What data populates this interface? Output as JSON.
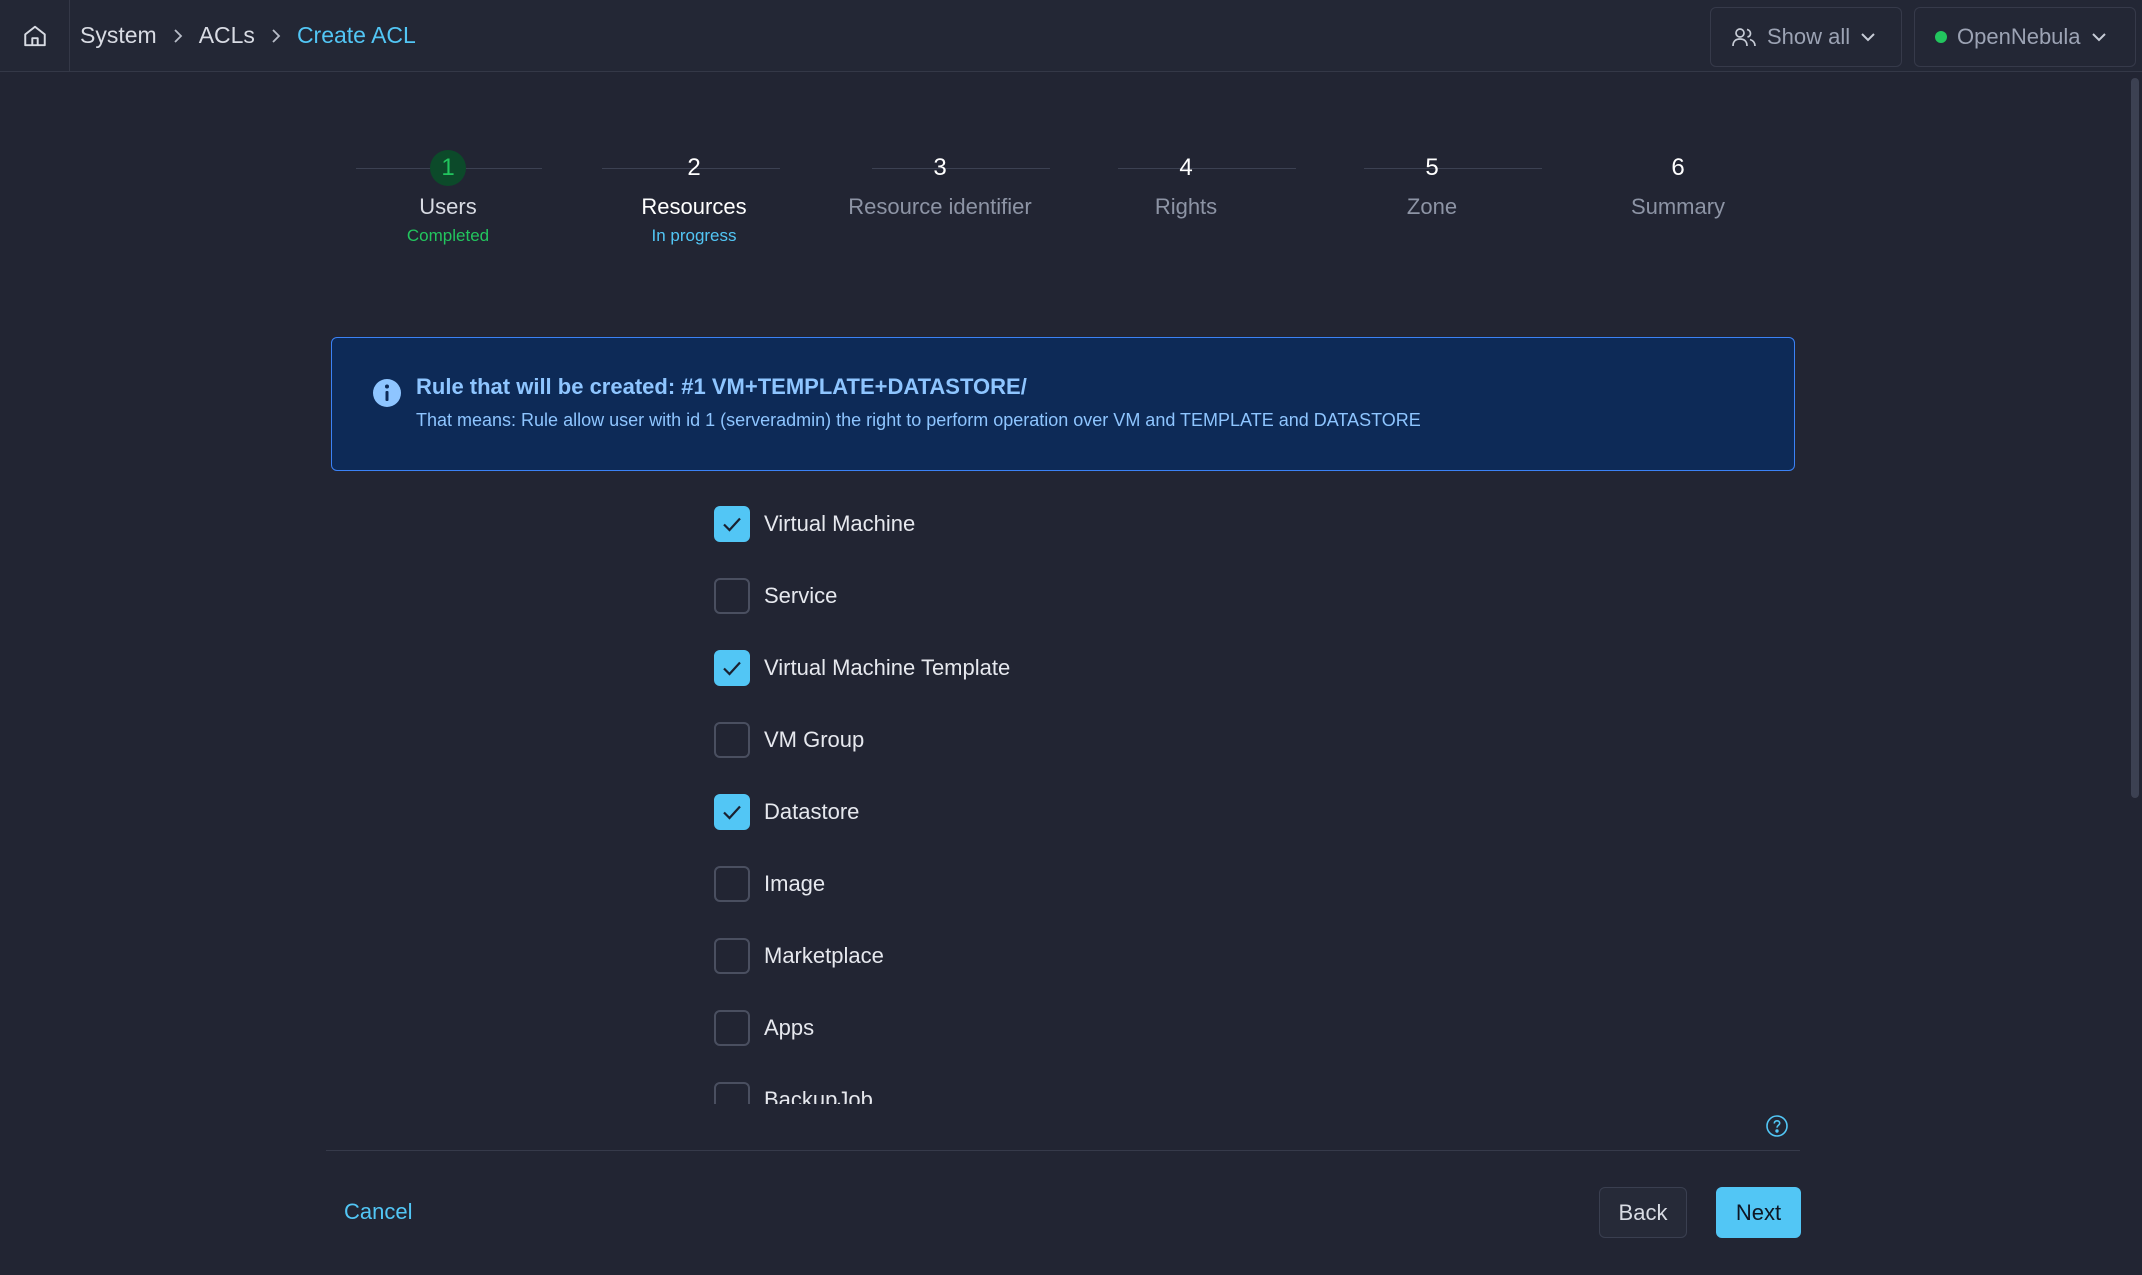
{
  "breadcrumb": {
    "items": [
      "System",
      "ACLs",
      "Create ACL"
    ]
  },
  "header": {
    "show_all_label": "Show all",
    "zone_label": "OpenNebula",
    "zone_status_color": "#22c55e"
  },
  "stepper": {
    "steps": [
      {
        "number": "1",
        "label": "Users",
        "status": "Completed"
      },
      {
        "number": "2",
        "label": "Resources",
        "status": "In progress"
      },
      {
        "number": "3",
        "label": "Resource identifier",
        "status": ""
      },
      {
        "number": "4",
        "label": "Rights",
        "status": ""
      },
      {
        "number": "5",
        "label": "Zone",
        "status": ""
      },
      {
        "number": "6",
        "label": "Summary",
        "status": ""
      }
    ]
  },
  "info": {
    "title": "Rule that will be created: #1 VM+TEMPLATE+DATASTORE/",
    "description": "That means: Rule allow user with id 1 (serveradmin) the right to perform operation over VM and TEMPLATE and DATASTORE"
  },
  "resources": [
    {
      "label": "Virtual Machine",
      "checked": true
    },
    {
      "label": "Service",
      "checked": false
    },
    {
      "label": "Virtual Machine Template",
      "checked": true
    },
    {
      "label": "VM Group",
      "checked": false
    },
    {
      "label": "Datastore",
      "checked": true
    },
    {
      "label": "Image",
      "checked": false
    },
    {
      "label": "Marketplace",
      "checked": false
    },
    {
      "label": "Apps",
      "checked": false
    },
    {
      "label": "BackupJob",
      "checked": false
    }
  ],
  "footer": {
    "cancel_label": "Cancel",
    "back_label": "Back",
    "next_label": "Next"
  },
  "colors": {
    "accent": "#52c6f5",
    "success": "#22c55e",
    "info_bg": "#0d2a57",
    "background": "#222533"
  }
}
